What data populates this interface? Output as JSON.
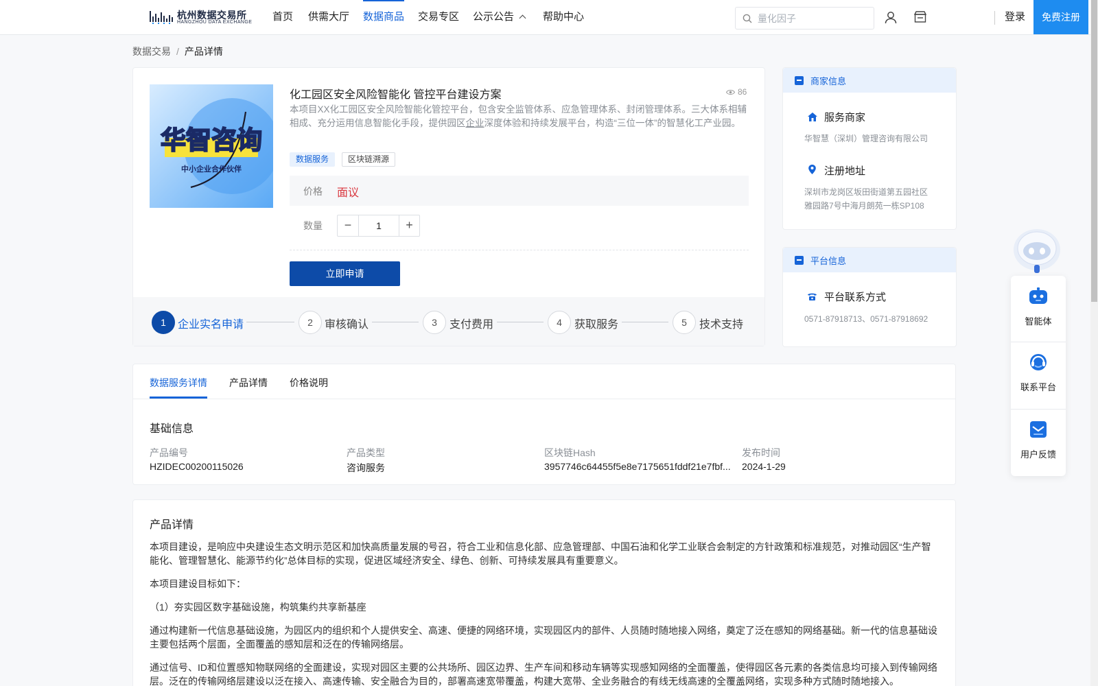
{
  "header": {
    "logo_cn": "杭州数据交易所",
    "logo_en": "HANGZHOU DATA EXCHANGE",
    "nav": [
      "首页",
      "供需大厅",
      "数据商品",
      "交易专区",
      "公示公告",
      "帮助中心"
    ],
    "active_nav": "数据商品",
    "search_placeholder": "量化因子",
    "login": "登录",
    "register": "免费注册",
    "icons": [
      "search-icon",
      "user-icon",
      "shop-icon",
      "chevron-up-icon"
    ]
  },
  "breadcrumb": {
    "parent": "数据交易",
    "separator": "/",
    "current": "产品详情"
  },
  "product": {
    "image_title": "华智咨询",
    "image_subtitle": "中小企业合作伙伴",
    "title": "化工园区安全风险智能化 管控平台建设方案",
    "views": "86",
    "desc_a": "本项目XX化工园区安全风险智能化管控平台，包含安全监管体系、应急管理体系、封闭管理体系。三大体系相辅相成、充分运用信息智能化手段，提供园区",
    "desc_link": "企业",
    "desc_b": "深度体验和持续发展平台，构造“三位一体”的智慧化工产业园。",
    "tags": [
      "数据服务",
      "区块链溯源"
    ],
    "price_label": "价格",
    "price": "面议",
    "qty_label": "数量",
    "qty_minus": "−",
    "quantity": "1",
    "qty_plus": "+",
    "apply": "立即申请"
  },
  "steps": [
    {
      "num": "1",
      "label": "企业实名申请"
    },
    {
      "num": "2",
      "label": "审核确认"
    },
    {
      "num": "3",
      "label": "支付费用"
    },
    {
      "num": "4",
      "label": "获取服务"
    },
    {
      "num": "5",
      "label": "技术支持"
    }
  ],
  "active_step": 1,
  "merchant": {
    "header": "商家信息",
    "service_label": "服务商家",
    "service_value": "华智慧（深圳）管理咨询有限公司",
    "address_label": "注册地址",
    "address_line1": "深圳市龙岗区坂田街道第五园社区",
    "address_line2": "雅园路7号中海月朗苑一栋SP108"
  },
  "platform": {
    "header": "平台信息",
    "contact_label": "平台联系方式",
    "contact_value": "0571-87918713、0571-87918692"
  },
  "helper": {
    "items": [
      "智能体",
      "联系平台",
      "用户反馈"
    ]
  },
  "tabs": [
    "数据服务详情",
    "产品详情",
    "价格说明"
  ],
  "active_tab": "数据服务详情",
  "basic_info": {
    "title": "基础信息",
    "fields": [
      {
        "label": "产品编号",
        "value": "HZIDEC00200115026"
      },
      {
        "label": "产品类型",
        "value": "咨询服务"
      },
      {
        "label": "区块链Hash",
        "value": "3957746c64455f5e8e7175651fddf21e7fbf..."
      },
      {
        "label": "发布时间",
        "value": "2024-1-29"
      }
    ]
  },
  "detail": {
    "title": "产品详情",
    "paragraphs": [
      "本项目建设，是响应中央建设生态文明示范区和加快高质量发展的号召，符合工业和信息化部、应急管理部、中国石油和化学工业联合会制定的方针政策和标准规范，对推动园区“生产智能化、管理智慧化、能源节约化”总体目标的实现，促进区域经济安全、绿色、创新、可持续发展具有重要意义。",
      "本项目建设目标如下：",
      "（1）夯实园区数字基础设施，构筑集约共享新基座",
      "通过构建新一代信息基础设施，为园区内的组织和个人提供安全、高速、便捷的网络环境，实现园区内的部件、人员随时随地接入网络，奠定了泛在感知的网络基础。新一代的信息基础设主要包括两个层面，全面覆盖的感知层和泛在的传输网络层。",
      "通过信号、ID和位置感知物联网络的全面建设，实现对园区主要的公共场所、园区边界、生产车间和移动车辆等实现感知网络的全面覆盖，使得园区各元素的各类信息均可接入到传输网络层。泛在的传输网络层建设以泛在接入、高速传输、安全融合为目的，部署高速宽带覆盖，构建大宽带、全业务融合的有线无线高速的全覆盖网络，实现多种方式随时随地接入。"
    ]
  },
  "colors": {
    "primary": "#1664d8",
    "button": "#0d4ba8",
    "price": "#d9363e",
    "register": "#1e8cf0"
  }
}
